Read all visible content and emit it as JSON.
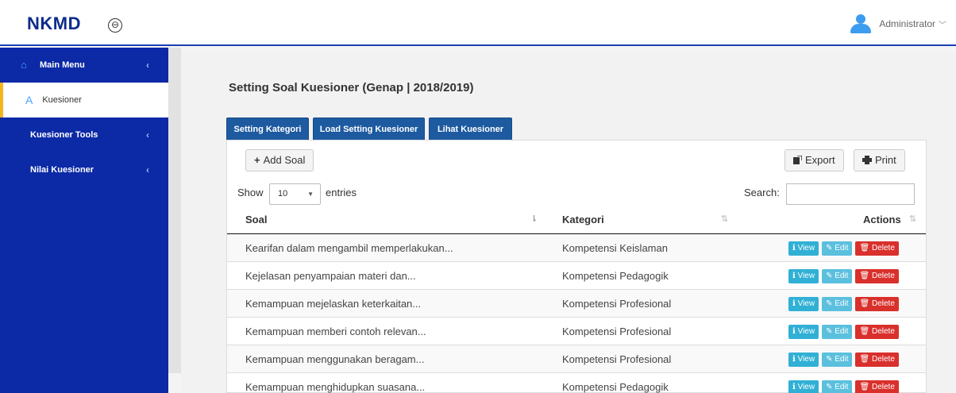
{
  "header": {
    "brand": "NKMD",
    "toggle_icon": "⊖",
    "user_name": "Administrator",
    "user_chevron": "﹀"
  },
  "sidebar": {
    "items": [
      {
        "label": "Main Menu",
        "icon": "home-icon",
        "caret": "‹"
      },
      {
        "label": "Kuesioner",
        "icon": "letter-a-icon"
      },
      {
        "label": "Kuesioner Tools",
        "caret": "‹"
      },
      {
        "label": "Nilai Kuesioner",
        "caret": "‹"
      }
    ]
  },
  "page": {
    "title": "Setting Soal Kuesioner (Genap | 2018/2019)"
  },
  "tabs": [
    "Setting Kategori",
    "Load Setting Kuesioner",
    "Lihat Kuesioner"
  ],
  "toolbar": {
    "add": "Add Soal",
    "add_icon": "+",
    "export": "Export",
    "print": "Print"
  },
  "table_controls": {
    "show": "Show",
    "page_size": "10",
    "entries": "entries",
    "search": "Search:"
  },
  "table": {
    "headers": [
      "Soal",
      "Kategori",
      "Actions"
    ],
    "actions": {
      "view": "View",
      "edit": "Edit",
      "delete": "Delete"
    },
    "rows": [
      {
        "soal": "Kearifan dalam mengambil memperlakukan...",
        "kategori": "Kompetensi Keislaman"
      },
      {
        "soal": "Kejelasan penyampaian materi dan...",
        "kategori": "Kompetensi Pedagogik"
      },
      {
        "soal": "Kemampuan mejelaskan keterkaitan...",
        "kategori": "Kompetensi Profesional"
      },
      {
        "soal": "Kemampuan memberi contoh relevan...",
        "kategori": "Kompetensi Profesional"
      },
      {
        "soal": "Kemampuan menggunakan beragam...",
        "kategori": "Kompetensi Profesional"
      },
      {
        "soal": "Kemampuan menghidupkan suasana...",
        "kategori": "Kompetensi Pedagogik"
      }
    ]
  },
  "colors": {
    "brand": "#0d2b8c",
    "sidebar": "#0c29a6",
    "tab": "#1d5aa0",
    "accent": "#f2b61d",
    "danger": "#d9302c",
    "info": "#31b0d5"
  }
}
